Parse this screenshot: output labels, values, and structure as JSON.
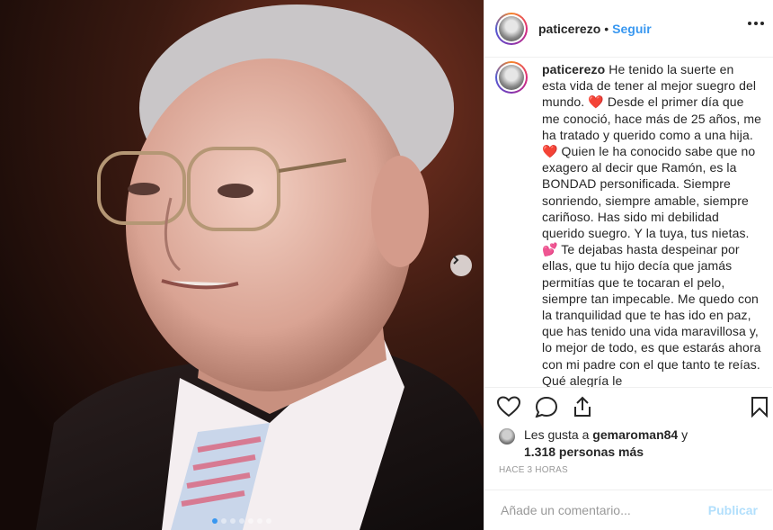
{
  "post": {
    "username": "paticerezo",
    "separator": "•",
    "follow_label": "Seguir",
    "carousel": {
      "slides": 7,
      "current": 1
    }
  },
  "caption": {
    "username": "paticerezo",
    "p1": "He tenido la suerte en esta vida de tener al mejor suegro del mundo.",
    "heart": "❤️",
    "p2": "Desde el primer día que me conoció, hace más de 25 años, me ha tratado y querido como a una hija.",
    "p3": "Quien le ha conocido sabe que no exagero al decir que Ramón, es la BONDAD personificada. Siempre sonriendo, siempre amable, siempre cariñoso. Has sido mi debilidad querido suegro. Y la tuya, tus nietas.",
    "hearts": "💕",
    "p4": "Te dejabas hasta despeinar por ellas, que tu hijo decía que jamás permitías que te tocaran el pelo, siempre tan impecable. Me quedo con la tranquilidad que te has ido en paz, que has tenido una vida maravillosa y, lo mejor de todo, es que estarás ahora con mi padre con el que tanto te reías. Qué alegría le"
  },
  "likes": {
    "prefix": "Les gusta a",
    "user": "gemaroman84",
    "conj": "y",
    "others": "1.318 personas más"
  },
  "timestamp": "HACE 3 HORAS",
  "comment": {
    "placeholder": "Añade un comentario...",
    "publish_label": "Publicar"
  },
  "icons": {
    "like": "heart-icon",
    "comment": "comment-bubble-icon",
    "share": "share-icon",
    "save": "bookmark-icon",
    "next": "chevron-right-icon",
    "more": "more-dots-icon"
  },
  "colors": {
    "accent": "#3897f0",
    "publish_disabled": "#b2dffc",
    "heart": "#e0245e"
  }
}
